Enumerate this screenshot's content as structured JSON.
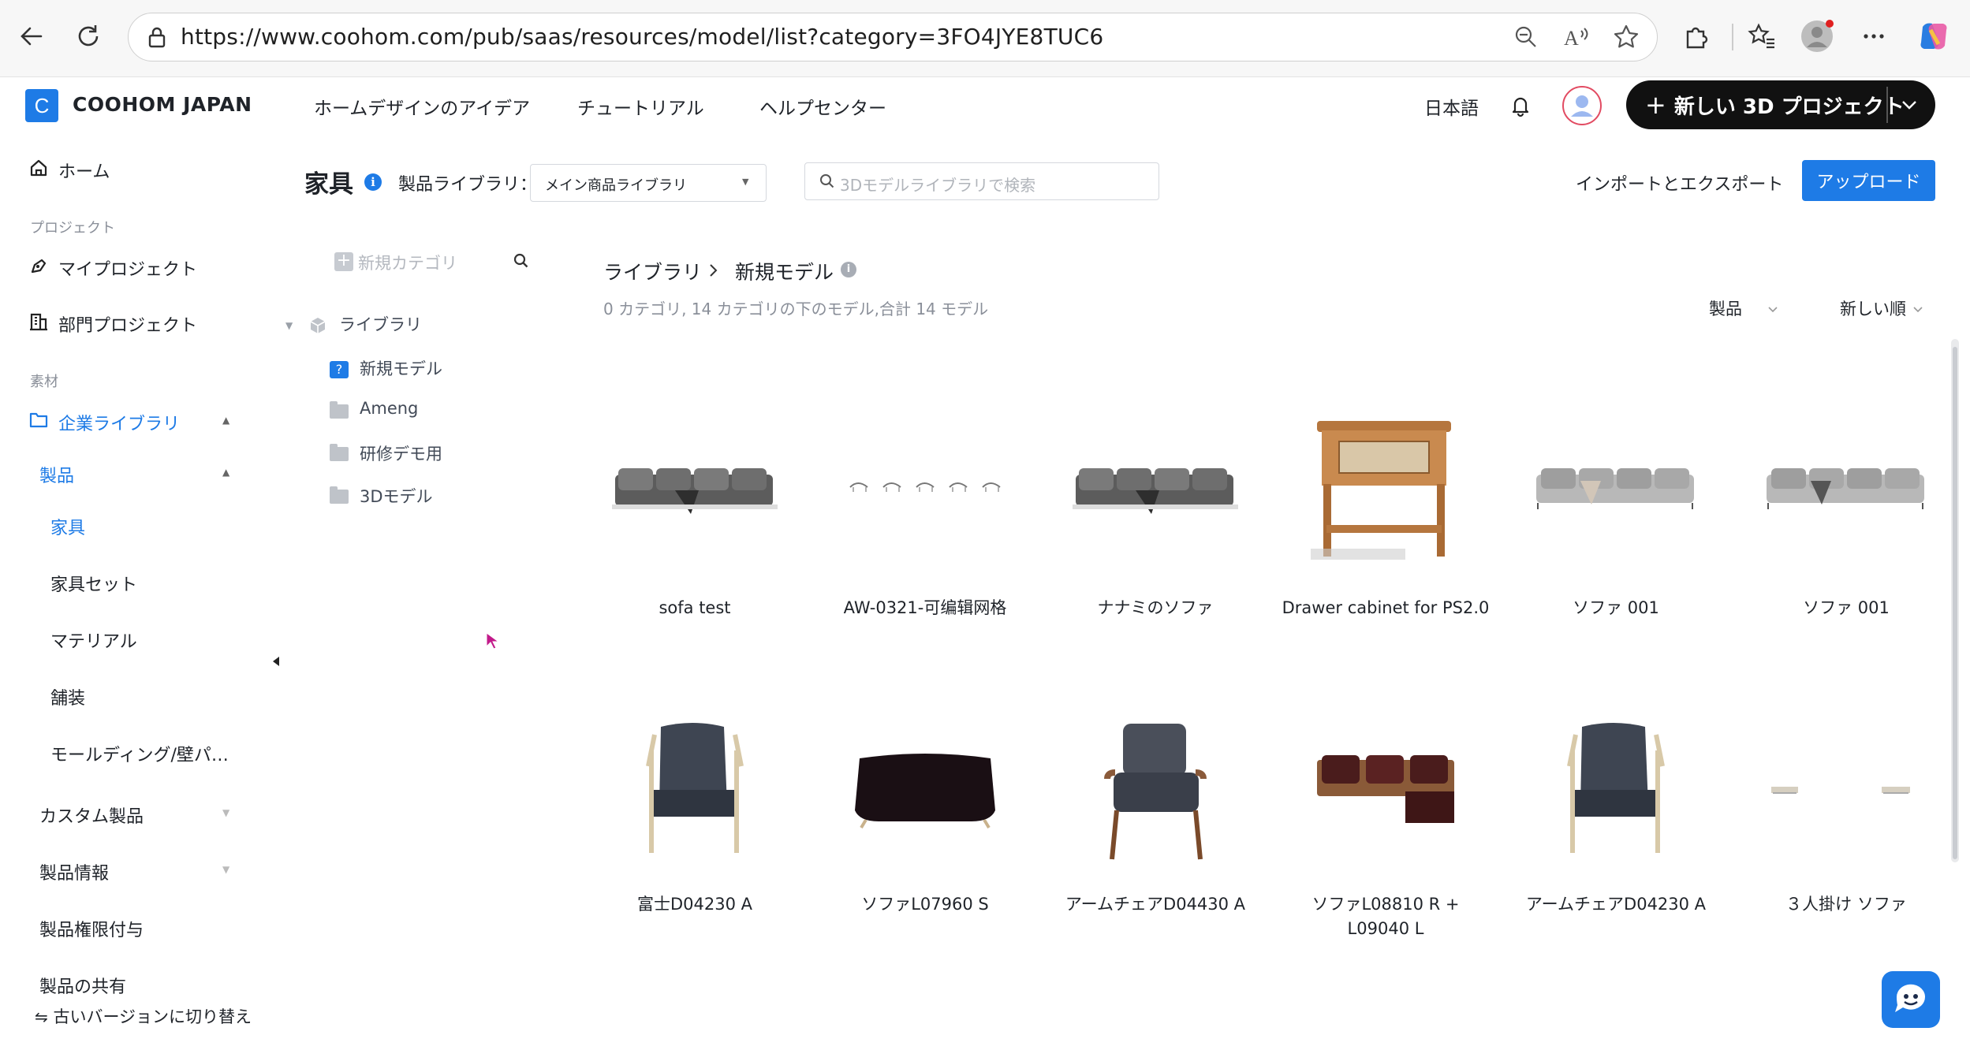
{
  "browser": {
    "url": "https://www.coohom.com/pub/saas/resources/model/list?category=3FO4JYE8TUC6"
  },
  "header": {
    "logo_letter": "C",
    "brand": "COOHOM JAPAN",
    "nav": [
      "ホームデザインのアイデア",
      "チュートリアル",
      "ヘルプセンター"
    ],
    "language": "日本語",
    "new_project_label": "新しい 3D プロジェクト"
  },
  "sidebar": {
    "home": "ホーム",
    "section_project": "プロジェクト",
    "my_projects": "マイプロジェクト",
    "dept_projects": "部門プロジェクト",
    "section_material": "素材",
    "enterprise_library": "企業ライブラリ",
    "products": "製品",
    "sub_items": [
      "家具",
      "家具セット",
      "マテリアル",
      "舗装",
      "モールディング/壁パ…"
    ],
    "custom_products": "カスタム製品",
    "product_info": "製品情報",
    "product_permission": "製品権限付与",
    "product_share": "製品の共有",
    "old_version": "古いバージョンに切り替え"
  },
  "toolbar": {
    "title": "家具",
    "library_label": "製品ライブラリ：",
    "library_value": "メイン商品ライブラリ",
    "search_placeholder": "3Dモデルライブラリで検索",
    "import_export": "インポートとエクスポート",
    "upload": "アップロード"
  },
  "tree": {
    "new_category": "新規カテゴリ",
    "root": "ライブラリ",
    "items": [
      "新規モデル",
      "Ameng",
      "研修デモ用",
      "3Dモデル"
    ]
  },
  "content": {
    "breadcrumb_root": "ライブラリ",
    "breadcrumb_current": "新規モデル",
    "summary": "0 カテゴリ, 14 カテゴリの下のモデル,合計 14 モデル",
    "filter_type": "製品",
    "sort": "新しい順",
    "cards": [
      {
        "label": "sofa test",
        "icon": "sofa-gray-icon"
      },
      {
        "label": "AW-0321-可编辑网格",
        "icon": "chairs-row-icon"
      },
      {
        "label": "ナナミのソファ",
        "icon": "sofa-gray-icon"
      },
      {
        "label": "Drawer cabinet for PS2.0",
        "icon": "wood-cabinet-icon"
      },
      {
        "label": "ソファ 001",
        "icon": "sofa-light-icon"
      },
      {
        "label": "ソファ 001",
        "icon": "sofa-light-icon"
      },
      {
        "label": "富士D04230 A",
        "icon": "armchair-wood-icon"
      },
      {
        "label": "ソファL07960 S",
        "icon": "sofa-dark-icon"
      },
      {
        "label": "アームチェアD04430 A",
        "icon": "armchair-cushion-icon"
      },
      {
        "label": "ソファL08810 R + L09040 L",
        "icon": "corner-sofa-icon"
      },
      {
        "label": "アームチェアD04230 A",
        "icon": "armchair-wood-icon"
      },
      {
        "label": "３人掛け ソファ",
        "icon": "sofa-small-icon"
      }
    ]
  },
  "colors": {
    "accent": "#1e7be6",
    "dark_button": "#111111"
  }
}
